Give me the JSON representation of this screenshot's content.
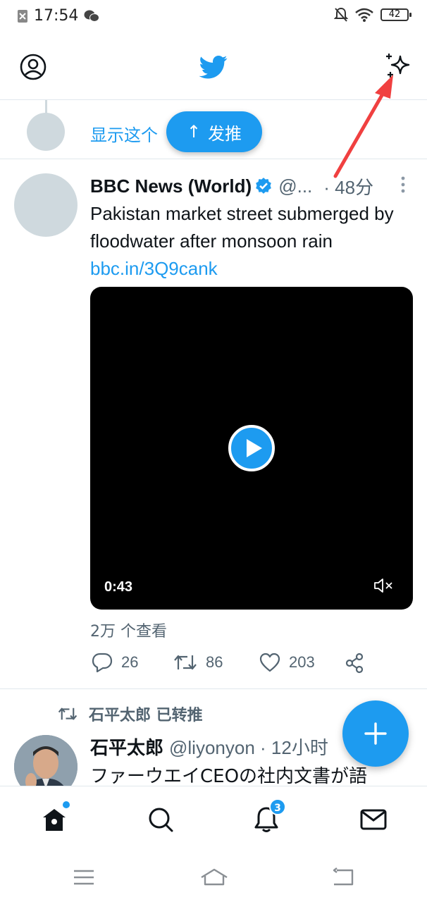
{
  "status_bar": {
    "time": "17:54",
    "battery": "42"
  },
  "header": {
    "profile_icon": "profile-icon",
    "logo_icon": "twitter-bird-icon",
    "sparkle_icon": "sparkle-icon"
  },
  "new_tweets": {
    "show_text": "显示这个",
    "pill_label": "发推",
    "pill_arrow": "↑"
  },
  "tweet": {
    "author_name": "BBC News (World)",
    "handle": "@...",
    "time": "· 48分",
    "text": "Pakistan market street submerged by floodwater after monsoon rain",
    "link": "bbc.in/3Q9cank",
    "video_duration": "0:43",
    "views": "2万 个查看",
    "replies": "26",
    "retweets": "86",
    "likes": "203"
  },
  "retweet": {
    "retweeted_by": "石平太郎 已转推",
    "author_name": "石平太郎",
    "handle": "@liyonyon · 12小时",
    "text": "ファーウエイCEOの社内文書が語"
  },
  "bottom_nav": {
    "notifications_count": "3"
  },
  "colors": {
    "accent": "#1d9bf0",
    "annotation": "#f04040"
  }
}
